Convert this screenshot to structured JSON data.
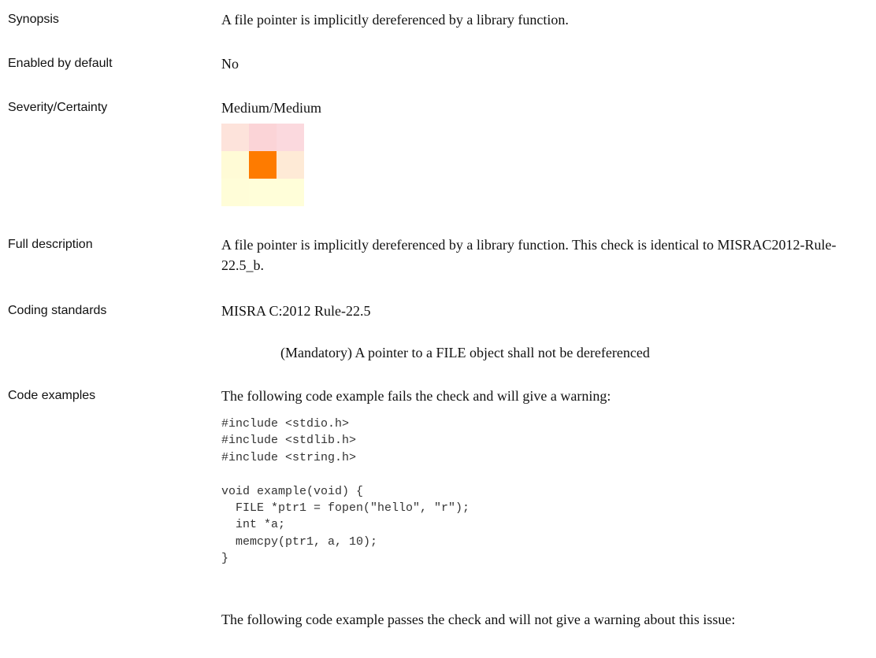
{
  "rows": {
    "synopsis": {
      "label": "Synopsis",
      "value": "A file pointer is implicitly dereferenced by a library function."
    },
    "enabled": {
      "label": "Enabled by default",
      "value": "No"
    },
    "severity": {
      "label": "Severity/Certainty",
      "value": "Medium/Medium",
      "matrix": {
        "selected": "Medium/Medium",
        "colors": [
          [
            "#fde3db",
            "#fbd4d7",
            "#fbd9de"
          ],
          [
            "#fffbd6",
            "#fe7b00",
            "#feead6"
          ],
          [
            "#fffdd8",
            "#fffed9",
            "#fffed9"
          ]
        ]
      }
    },
    "full_description": {
      "label": "Full description",
      "value": "A file pointer is implicitly dereferenced by a library function. This check is identical to MISRAC2012-Rule-22.5_b."
    },
    "coding_standards": {
      "label": "Coding standards",
      "value": "MISRA C:2012 Rule-22.5",
      "detail": "(Mandatory) A pointer to a FILE object shall not be dereferenced"
    },
    "code_examples": {
      "label": "Code examples",
      "intro_fail": "The following code example fails the check and will give a warning:",
      "code": "#include <stdio.h>\n#include <stdlib.h>\n#include <string.h>\n\nvoid example(void) {\n  FILE *ptr1 = fopen(\"hello\", \"r\");\n  int *a;\n  memcpy(ptr1, a, 10);\n}",
      "intro_pass": "The following code example passes the check and will not give a warning about this issue:"
    }
  }
}
